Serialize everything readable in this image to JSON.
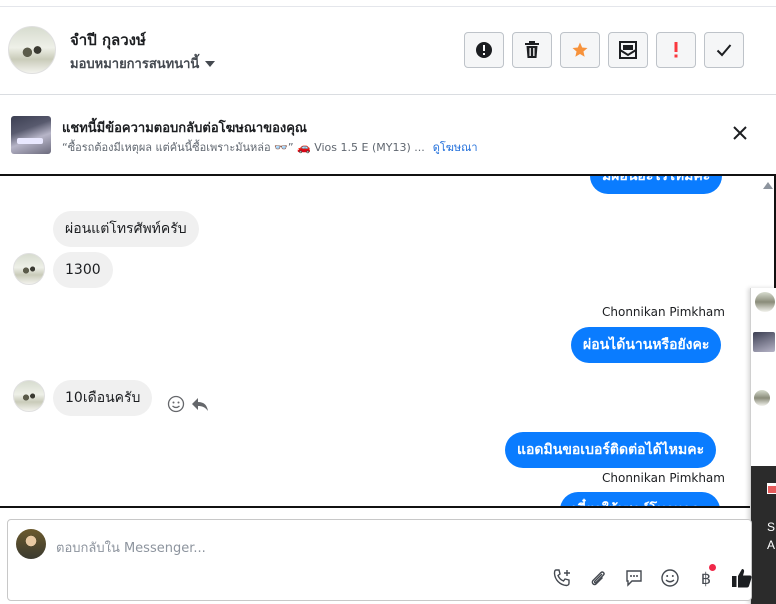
{
  "contact": {
    "name": "จำปี กุลวงษ์",
    "assign_label": "มอบหมายการสนทนานี้"
  },
  "header_actions": [
    {
      "icon": "alert-circle-icon",
      "label": "spam"
    },
    {
      "icon": "trash-icon",
      "label": "delete"
    },
    {
      "icon": "star-icon",
      "label": "star",
      "color": "#f7923b"
    },
    {
      "icon": "mark-unread-icon",
      "label": "mark unread"
    },
    {
      "icon": "exclamation-icon",
      "label": "follow up",
      "color": "#fa383e"
    },
    {
      "icon": "check-icon",
      "label": "done"
    }
  ],
  "ad_banner": {
    "title": "แชทนี้มีข้อความตอบกลับต่อโฆษณาของคุณ",
    "snippet": "“ซื้อรถต้องมีเหตุผล แต่คันนี้ซื้อเพราะมันหล่อ 👓” 🚗 Vios 1.5 E (MY13) ...",
    "link": "ดูโฆษณา"
  },
  "messages": {
    "partial_top": "มีผ่อนอะไรไหมคะ",
    "m1": "ผ่อนแต่โทรศัพท์ครับ",
    "m2": "1300",
    "sender1": "Chonnikan Pimkham",
    "m3": "ผ่อนได้นานหรือยังคะ",
    "m4": "10เดือนครับ",
    "m5": "แอดมินขอเบอร์ติดต่อได้ไหมคะ",
    "sender2": "Chonnikan Pimkham",
    "partial_bottom": "เดี๋ยวให้เซลล์โทรหาคะ"
  },
  "side_panel": {
    "text1": "S",
    "text2": "A"
  },
  "composer": {
    "placeholder": "ตอบกลับใน Messenger..."
  },
  "colors": {
    "outgoing_bubble": "#0a7cff",
    "incoming_bubble": "#f0f0f0",
    "link": "#216fdb"
  }
}
